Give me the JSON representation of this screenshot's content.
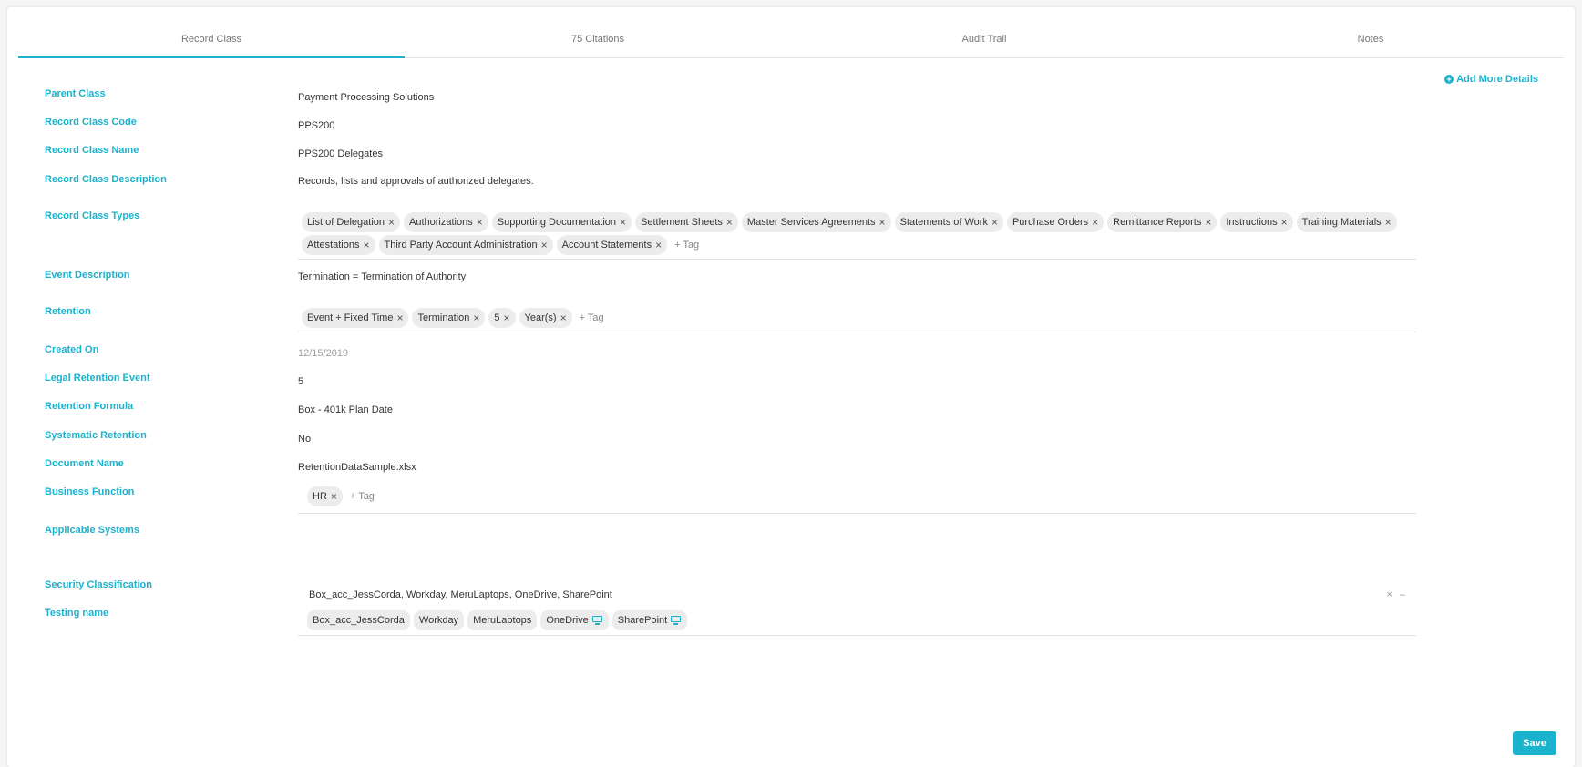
{
  "tabs": [
    "Record Class",
    "75 Citations",
    "Audit Trail",
    "Notes"
  ],
  "add_more_label": "Add More Details",
  "fields": {
    "parent_class": {
      "label": "Parent Class",
      "value": "Payment Processing Solutions"
    },
    "record_class_code": {
      "label": "Record Class Code",
      "value": "PPS200"
    },
    "record_class_name": {
      "label": "Record Class Name",
      "value": "PPS200 Delegates"
    },
    "record_class_description": {
      "label": "Record Class Description",
      "value": "Records, lists and approvals of authorized delegates."
    },
    "record_class_types": {
      "label": "Record Class Types"
    },
    "event_description": {
      "label": "Event Description",
      "value": "Termination = Termination of Authority"
    },
    "retention": {
      "label": "Retention"
    },
    "created_on": {
      "label": "Created On",
      "value": "12/15/2019"
    },
    "legal_retention_event": {
      "label": "Legal Retention Event",
      "value": "5"
    },
    "retention_formula": {
      "label": "Retention Formula",
      "value": "Box - 401k Plan Date"
    },
    "systematic_retention": {
      "label": "Systematic Retention",
      "value": "No"
    },
    "document_name": {
      "label": "Document Name",
      "value": "RetentionDataSample.xlsx"
    },
    "business_function": {
      "label": "Business Function"
    },
    "applicable_systems": {
      "label": "Applicable Systems",
      "summary": "Box_acc_JessCorda, Workday, MeruLaptops, OneDrive, SharePoint"
    },
    "security_classification": {
      "label": "Security Classification"
    },
    "testing_name": {
      "label": "Testing name"
    }
  },
  "record_class_types_tags": [
    "List of Delegation",
    "Authorizations",
    "Supporting Documentation",
    "Settlement Sheets",
    "Master Services Agreements",
    "Statements of Work",
    "Purchase Orders",
    "Remittance Reports",
    "Instructions",
    "Training Materials",
    "Attestations",
    "Third Party Account Administration",
    "Account Statements"
  ],
  "retention_tags": [
    "Event + Fixed Time",
    "Termination",
    "5",
    "Year(s)"
  ],
  "business_function_tags": [
    "HR"
  ],
  "applicable_systems_chips": [
    "Box_acc_JessCorda",
    "Workday",
    "MeruLaptops",
    "OneDrive",
    "SharePoint"
  ],
  "add_tag_label": "+ Tag",
  "remove_glyph": "×",
  "clear_glyph": "×",
  "collapse_glyph": "–",
  "save_label": "Save",
  "colors": {
    "accent": "#1ab2cc",
    "tag_bg": "#ececec"
  }
}
